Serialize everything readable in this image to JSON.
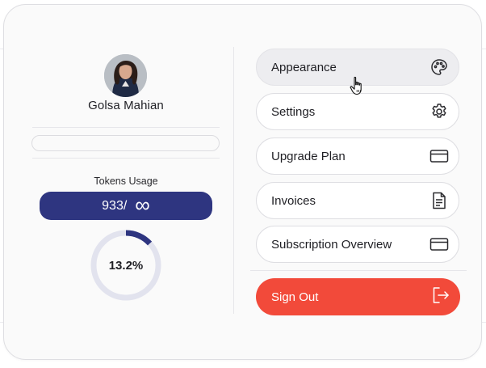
{
  "profile": {
    "name": "Golsa Mahian",
    "avatar_icon": "user-photo"
  },
  "usage": {
    "label": "Tokens Usage",
    "used": "933/",
    "limit_symbol": "∞",
    "percent_text": "13.2%",
    "percent": 0.132,
    "pill_color": "#2e3580",
    "gauge_color": "#2e3580",
    "gauge_track_color": "#e2e3ee"
  },
  "menu": {
    "items": [
      {
        "label": "Appearance",
        "icon": "palette-icon"
      },
      {
        "label": "Settings",
        "icon": "gear-icon"
      },
      {
        "label": "Upgrade Plan",
        "icon": "credit-card-icon"
      },
      {
        "label": "Invoices",
        "icon": "document-icon"
      },
      {
        "label": "Subscription Overview",
        "icon": "credit-card-icon"
      }
    ],
    "signout": {
      "label": "Sign Out",
      "icon": "logout-icon",
      "color": "#f24a3a"
    }
  }
}
